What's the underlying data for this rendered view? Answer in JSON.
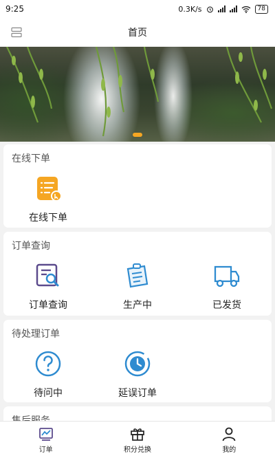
{
  "status_bar": {
    "time": "9:25",
    "net_speed": "0.3K/s",
    "battery": "78"
  },
  "header": {
    "title": "首页"
  },
  "sections": {
    "online_order": {
      "title": "在线下单",
      "items": [
        {
          "label": "在线下单",
          "icon": "order-form-icon"
        }
      ]
    },
    "order_query": {
      "title": "订单查询",
      "items": [
        {
          "label": "订单查询",
          "icon": "search-document-icon"
        },
        {
          "label": "生产中",
          "icon": "clipboard-icon"
        },
        {
          "label": "已发货",
          "icon": "truck-icon"
        }
      ]
    },
    "pending_orders": {
      "title": "待处理订单",
      "items": [
        {
          "label": "待问中",
          "icon": "question-icon"
        },
        {
          "label": "延误订单",
          "icon": "clock-icon"
        }
      ]
    },
    "after_sales": {
      "title": "售后服务"
    }
  },
  "tabs": [
    {
      "label": "订单",
      "icon": "chart-monitor-icon",
      "active": true
    },
    {
      "label": "积分兑换",
      "icon": "gift-icon",
      "active": false
    },
    {
      "label": "我的",
      "icon": "user-icon",
      "active": false
    }
  ],
  "colors": {
    "accent": "#f5a623",
    "icon_blue": "#2e8bd0",
    "icon_purple": "#5b4a8c"
  }
}
